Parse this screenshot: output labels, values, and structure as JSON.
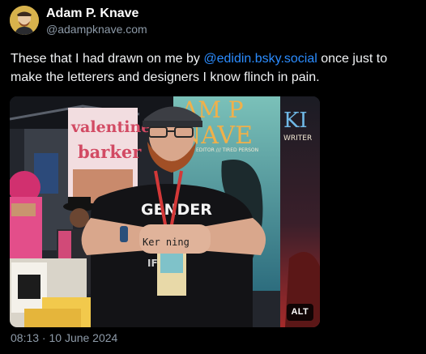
{
  "author": {
    "display_name": "Adam P. Knave",
    "handle": "@adampknave.com"
  },
  "post": {
    "text_before": "These that I had drawn on me by ",
    "mention": "@edidin.bsky.social",
    "text_after": " once just to make the letterers and designers I know flinch in pain.",
    "timestamp": "08:13 · 10 June 2024"
  },
  "media": {
    "alt_label": "ALT",
    "banner_left_line1": "valentine",
    "banner_left_line2": "barker",
    "banner_center_line1": "AM P",
    "banner_center_line2": "NAVE",
    "banner_center_sub": "EDITOR /// TIRED PERSON",
    "banner_right_title": "KI",
    "banner_right_sub": "WRITER",
    "shirt_text": "GENDER",
    "shirt_text_2": "IF",
    "knuckle_tattoo": "Ker  ning"
  },
  "colors": {
    "mention": "#2b8cff",
    "muted": "#8d9aa8",
    "background": "#000000"
  }
}
